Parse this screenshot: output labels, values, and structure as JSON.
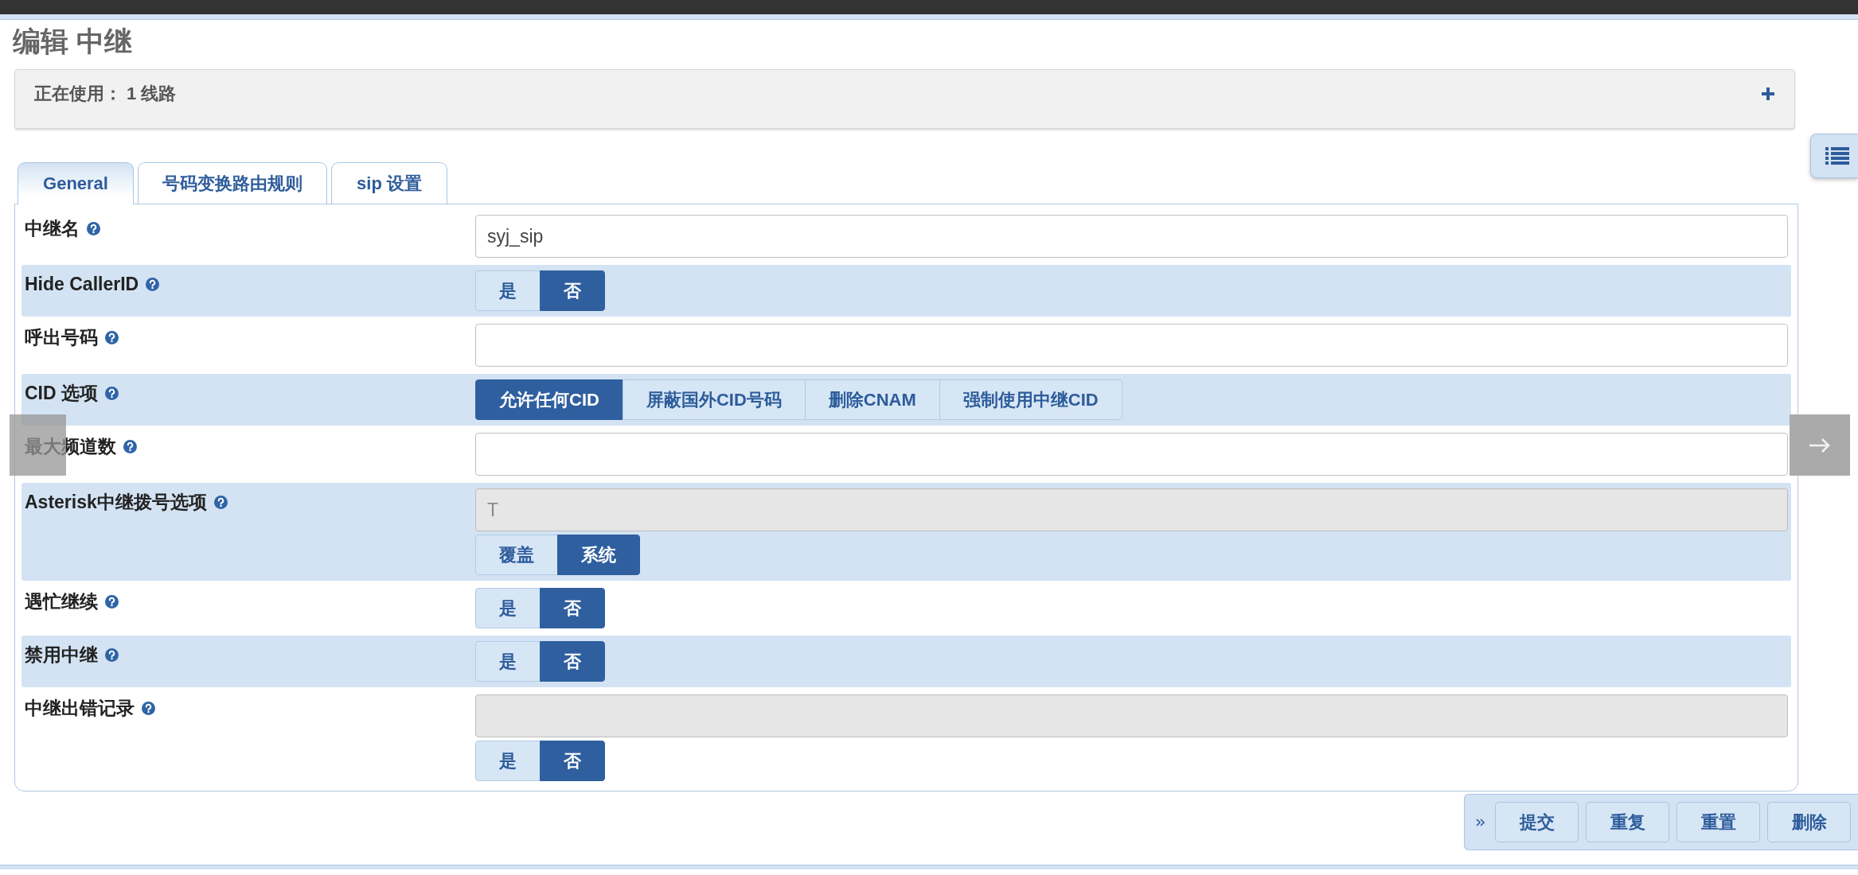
{
  "page": {
    "title": "编辑 中继"
  },
  "usage_panel": {
    "text": "正在使用： 1 线路"
  },
  "tabs": [
    {
      "label": "General",
      "selected": true
    },
    {
      "label": "号码变换路由规则",
      "selected": false
    },
    {
      "label": "sip 设置",
      "selected": false
    }
  ],
  "fields": [
    {
      "kind": "text",
      "label": "中继名",
      "value": "syj_sip",
      "disabled": false
    },
    {
      "kind": "toggle",
      "label": "Hide CallerID",
      "options": [
        {
          "label": "是",
          "selected": false
        },
        {
          "label": "否",
          "selected": true
        }
      ]
    },
    {
      "kind": "text",
      "label": "呼出号码",
      "disabled": false
    },
    {
      "kind": "toggle",
      "label": "CID 选项",
      "options": [
        {
          "label": "允许任何CID",
          "selected": true
        },
        {
          "label": "屏蔽国外CID号码",
          "selected": false
        },
        {
          "label": "删除CNAM",
          "selected": false
        },
        {
          "label": "强制使用中继CID",
          "selected": false
        }
      ]
    },
    {
      "kind": "text",
      "label": "最大频道数",
      "disabled": false
    },
    {
      "kind": "text_toggle",
      "label": "Asterisk中继拨号选项",
      "value": "T",
      "disabled": true,
      "options": [
        {
          "label": "覆盖",
          "selected": false
        },
        {
          "label": "系统",
          "selected": true
        }
      ]
    },
    {
      "kind": "toggle",
      "label": "遇忙继续",
      "options": [
        {
          "label": "是",
          "selected": false
        },
        {
          "label": "否",
          "selected": true
        }
      ]
    },
    {
      "kind": "toggle",
      "label": "禁用中继",
      "options": [
        {
          "label": "是",
          "selected": false
        },
        {
          "label": "否",
          "selected": true
        }
      ]
    },
    {
      "kind": "text_toggle",
      "label": "中继出错记录",
      "disabled": true,
      "options": [
        {
          "label": "是",
          "selected": false
        },
        {
          "label": "否",
          "selected": true
        }
      ]
    }
  ],
  "actions": [
    "提交",
    "重复",
    "重置",
    "删除"
  ]
}
